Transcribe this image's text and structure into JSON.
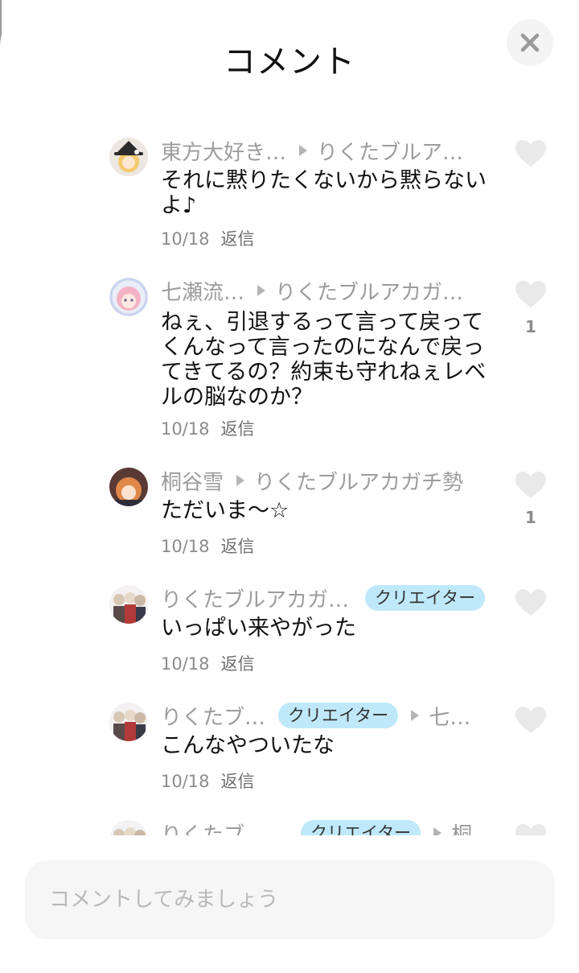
{
  "header": {
    "title": "コメント"
  },
  "comments": [
    {
      "avatar": "avatar-blonde-witch",
      "name": "東方大好き…",
      "badge": "",
      "reply_to": "りくたブルア…",
      "text": "それに黙りたくないから黙らないよ♪",
      "date": "10/18",
      "reply_label": "返信",
      "likes": ""
    },
    {
      "avatar": "avatar-pink-hair",
      "name": "七瀬流…",
      "badge": "",
      "reply_to": "りくたブルアカガ…",
      "text": "ねぇ、引退するって言って戻ってくんなって言ったのになんで戻ってきてるの？約束も守れねぇレベルの脳なのか？",
      "date": "10/18",
      "reply_label": "返信",
      "likes": "1"
    },
    {
      "avatar": "avatar-orange-hair",
      "name": "桐谷雪",
      "badge": "",
      "reply_to": "りくたブルアカガチ勢",
      "text": "ただいま〜☆",
      "date": "10/18",
      "reply_label": "返信",
      "likes": "1"
    },
    {
      "avatar": "avatar-group-art",
      "name": "りくたブルアカガ…",
      "badge": "クリエイター",
      "reply_to": "",
      "text": "いっぱい来やがった",
      "date": "10/18",
      "reply_label": "返信",
      "likes": ""
    },
    {
      "avatar": "avatar-group-art",
      "name": "りくたブ…",
      "badge": "クリエイター",
      "reply_to": "七…",
      "text": "こんなやついたな",
      "date": "10/18",
      "reply_label": "返信",
      "likes": ""
    },
    {
      "avatar": "avatar-group-art",
      "name": "りくたブル…",
      "badge": "クリエイター",
      "reply_to": "桐",
      "text": "",
      "date": "",
      "reply_label": "",
      "likes": ""
    }
  ],
  "input": {
    "placeholder": "コメントしてみましょう",
    "value": ""
  },
  "icons": {
    "close": "close-icon",
    "like": "heart-icon",
    "reply_arrow": "play-arrow-icon"
  },
  "colors": {
    "badge_bg": "#bfe9fb",
    "meta_text": "#9c9c9c",
    "heart": "#e9e9e9"
  }
}
